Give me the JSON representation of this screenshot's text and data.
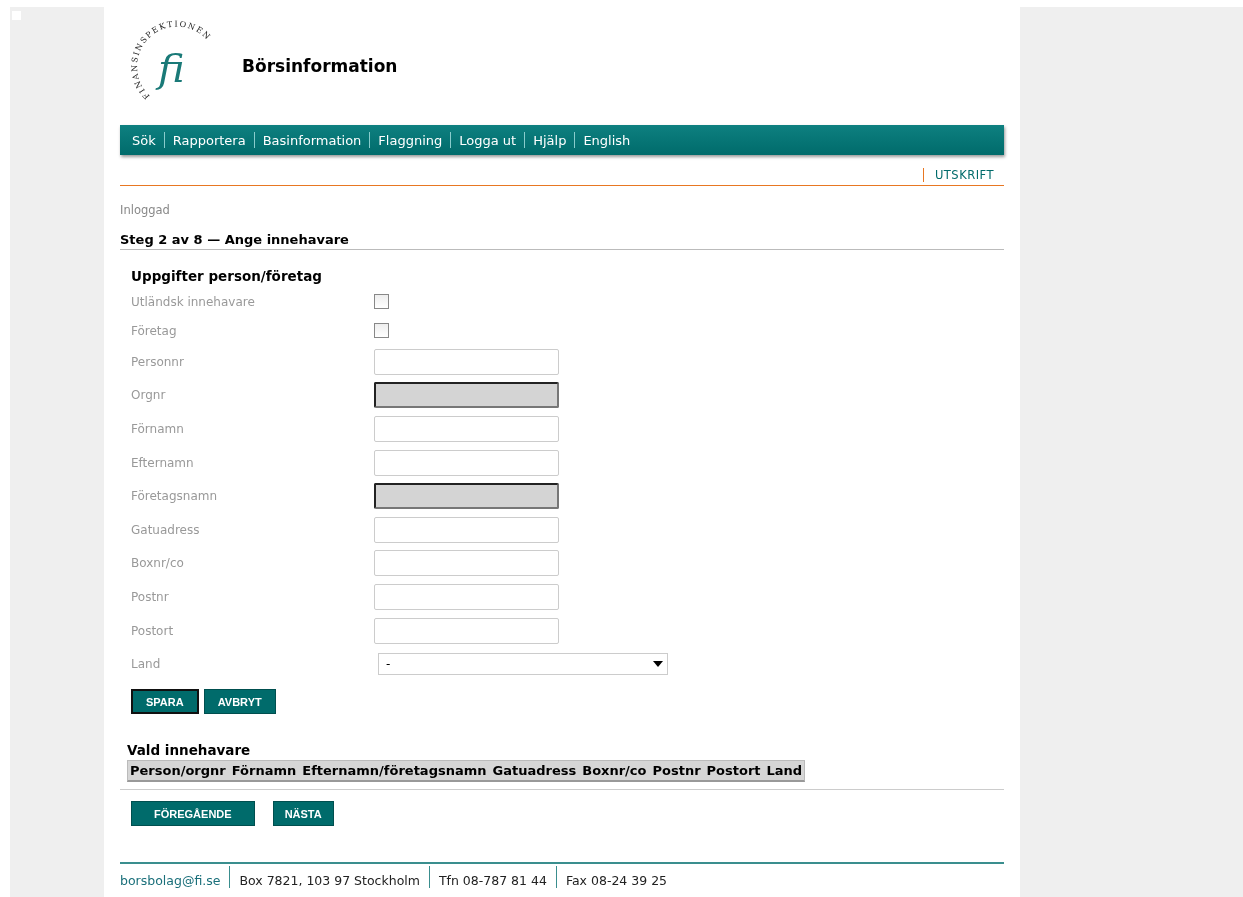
{
  "logo": {
    "ring_text": "FINANSINSPEKTIONEN",
    "mark": "fi"
  },
  "site_title": "Börsinformation",
  "nav": [
    "Sök",
    "Rapportera",
    "Basinformation",
    "Flaggning",
    "Logga ut",
    "Hjälp",
    "English"
  ],
  "print_link": "UTSKRIFT",
  "status": "Inloggad",
  "step_title": "Steg 2 av 8 — Ange innehavare",
  "form": {
    "title": "Uppgifter person/företag",
    "rows": [
      {
        "kind": "checkbox",
        "label": "Utländsk innehavare",
        "checked": false
      },
      {
        "kind": "checkbox",
        "label": "Företag",
        "checked": false
      },
      {
        "kind": "text",
        "label": "Personnr",
        "disabled": false
      },
      {
        "kind": "text",
        "label": "Orgnr",
        "disabled": true
      },
      {
        "kind": "text",
        "label": "Förnamn",
        "disabled": false
      },
      {
        "kind": "text",
        "label": "Efternamn",
        "disabled": false
      },
      {
        "kind": "text",
        "label": "Företagsnamn",
        "disabled": true
      },
      {
        "kind": "text",
        "label": "Gatuadress",
        "disabled": false
      },
      {
        "kind": "text",
        "label": "Boxnr/co",
        "disabled": false
      },
      {
        "kind": "text",
        "label": "Postnr",
        "disabled": false
      },
      {
        "kind": "text",
        "label": "Postort",
        "disabled": false
      },
      {
        "kind": "select",
        "label": "Land",
        "value": "-"
      }
    ],
    "buttons": [
      {
        "label": "SPARA",
        "focused": true
      },
      {
        "label": "AVBRYT",
        "focused": false
      }
    ]
  },
  "selected_holder": {
    "title": "Vald innehavare",
    "columns": [
      "Person/orgnr",
      "Förnamn",
      "Efternamn/företagsnamn",
      "Gatuadress",
      "Boxnr/co",
      "Postnr",
      "Postort",
      "Land"
    ]
  },
  "nav_buttons": [
    "FÖREGÅENDE",
    "NÄSTA"
  ],
  "footer": [
    {
      "kind": "link",
      "text": "borsbolag@fi.se"
    },
    {
      "kind": "text",
      "text": "Box 7821, 103 97 Stockholm"
    },
    {
      "kind": "text",
      "text": "Tfn 08-787 81 44"
    },
    {
      "kind": "text",
      "text": "Fax 08-24 39 25"
    }
  ]
}
